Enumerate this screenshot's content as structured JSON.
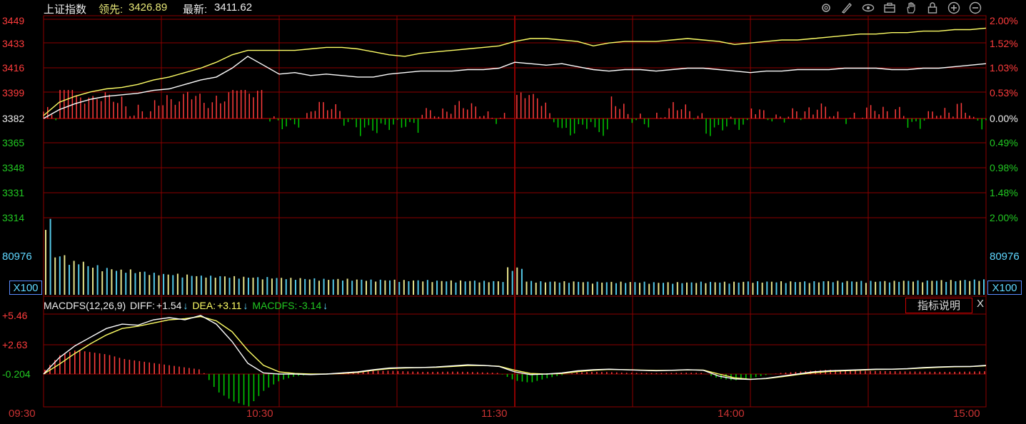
{
  "header": {
    "index_name": "上证指数",
    "lead_label": "领先:",
    "lead_value": "3426.89",
    "latest_label": "最新:",
    "latest_value": "3411.62"
  },
  "toolbar": {
    "icons": [
      "settings-icon",
      "pen-icon",
      "eye-icon",
      "briefcase-icon",
      "hand-icon",
      "lock-icon",
      "zoom-in-icon",
      "zoom-out-icon"
    ]
  },
  "price_axis": {
    "left_ticks": [
      "3449",
      "3433",
      "3416",
      "3399",
      "3382",
      "3365",
      "3348",
      "3331",
      "3314"
    ],
    "right_ticks": [
      "2.00%",
      "1.52%",
      "1.03%",
      "0.53%",
      "0.00%",
      "0.49%",
      "0.98%",
      "1.48%",
      "2.00%"
    ]
  },
  "volume_axis": {
    "max_label": "80976",
    "unit_label": "X100"
  },
  "macd": {
    "name": "MACDFS(12,26,9)",
    "diff_label": "DIFF:",
    "diff_value": "+1.54",
    "dea_label": "DEA:",
    "dea_value": "+3.11",
    "macdfs_label": "MACDFS:",
    "macdfs_value": "-3.14",
    "arrow": "↓",
    "ticks": [
      "+5.46",
      "+2.63",
      "-0.204"
    ],
    "explain_button": "指标说明",
    "close_button": "X"
  },
  "time_axis": [
    "09:30",
    "10:30",
    "11:30",
    "14:00",
    "15:00"
  ],
  "colors": {
    "grid": "#8c0000",
    "up": "#ff3c3c",
    "down": "#00c800",
    "white_line": "#ffffff",
    "yellow_line": "#ffff66",
    "lead_value": "#e8e878",
    "vol_yellow": "#e8e48c",
    "vol_cyan": "#54c8e8",
    "left_up_label": "#ff3c3c",
    "left_down_label": "#00c800"
  },
  "chart_data": {
    "type": "line",
    "title": "上证指数",
    "series": [
      {
        "name": "最新",
        "values": [
          3382,
          3388,
          3392,
          3395,
          3397,
          3398,
          3399,
          3401,
          3402,
          3405,
          3408,
          3410,
          3416,
          3424,
          3418,
          3412,
          3413,
          3411,
          3412,
          3411,
          3410,
          3410,
          3412,
          3413,
          3414,
          3414,
          3414,
          3415,
          3415,
          3416,
          3420,
          3419,
          3418,
          3419,
          3417,
          3415,
          3414,
          3415,
          3415,
          3414,
          3415,
          3416,
          3416,
          3415,
          3414,
          3413,
          3414,
          3414,
          3415,
          3415,
          3415,
          3416,
          3416,
          3416,
          3415,
          3415,
          3416,
          3416,
          3417,
          3418,
          3419
        ]
      },
      {
        "name": "领先",
        "values": [
          3384,
          3393,
          3397,
          3400,
          3402,
          3403,
          3405,
          3408,
          3410,
          3413,
          3416,
          3420,
          3425,
          3428,
          3428,
          3428,
          3428,
          3429,
          3430,
          3430,
          3429,
          3427,
          3425,
          3424,
          3426,
          3427,
          3428,
          3429,
          3430,
          3431,
          3434,
          3436,
          3436,
          3435,
          3434,
          3431,
          3433,
          3434,
          3434,
          3434,
          3435,
          3436,
          3435,
          3434,
          3432,
          3433,
          3434,
          3435,
          3435,
          3436,
          3437,
          3438,
          3439,
          3439,
          3440,
          3440,
          3441,
          3441,
          3442,
          3442,
          3443
        ]
      }
    ],
    "volume": [
      180,
      95,
      80,
      70,
      64,
      60,
      56,
      52,
      50,
      48,
      46,
      45,
      44,
      43,
      42,
      41,
      40,
      39,
      38,
      38,
      37,
      36,
      36,
      35,
      35,
      34,
      34,
      34,
      33,
      33,
      65,
      33,
      32,
      32,
      32,
      31,
      31,
      31,
      31,
      30,
      30,
      30,
      31,
      31,
      31,
      32,
      32,
      32,
      32,
      32,
      33,
      33,
      33,
      33,
      33,
      34,
      34,
      35,
      35,
      36,
      37
    ],
    "volume_unit": "X100",
    "macd_diff": [
      0.0,
      1.5,
      2.6,
      3.4,
      4.2,
      4.6,
      4.5,
      5.0,
      5.2,
      5.0,
      5.4,
      4.6,
      3.0,
      1.0,
      0.1,
      0.0,
      0.0,
      -0.05,
      0.0,
      0.1,
      0.2,
      0.4,
      0.55,
      0.6,
      0.6,
      0.65,
      0.75,
      0.85,
      0.8,
      0.7,
      0.2,
      -0.05,
      0.0,
      0.1,
      0.3,
      0.4,
      0.45,
      0.4,
      0.35,
      0.3,
      0.35,
      0.4,
      0.35,
      -0.2,
      -0.45,
      -0.5,
      -0.4,
      -0.2,
      0.0,
      0.2,
      0.3,
      0.35,
      0.4,
      0.45,
      0.45,
      0.5,
      0.6,
      0.65,
      0.7,
      0.7,
      0.8
    ],
    "macd_dea": [
      0.0,
      0.9,
      1.9,
      2.8,
      3.6,
      4.2,
      4.4,
      4.7,
      5.0,
      5.1,
      5.3,
      4.9,
      3.9,
      2.2,
      0.8,
      0.2,
      0.05,
      0.0,
      0.0,
      0.05,
      0.15,
      0.35,
      0.5,
      0.55,
      0.6,
      0.62,
      0.7,
      0.78,
      0.78,
      0.72,
      0.35,
      0.05,
      0.0,
      0.05,
      0.22,
      0.35,
      0.42,
      0.4,
      0.37,
      0.33,
      0.34,
      0.38,
      0.36,
      0.0,
      -0.35,
      -0.48,
      -0.42,
      -0.25,
      -0.05,
      0.12,
      0.24,
      0.3,
      0.36,
      0.42,
      0.44,
      0.48,
      0.56,
      0.62,
      0.67,
      0.69,
      0.76
    ],
    "macd_hist": [
      0.4,
      1.8,
      2.2,
      2.0,
      1.8,
      1.4,
      1.2,
      1.0,
      0.8,
      0.6,
      0.4,
      -1.6,
      -2.5,
      -3.0,
      -1.5,
      -0.6,
      -0.2,
      -0.05,
      0.05,
      0.15,
      0.25,
      0.3,
      0.3,
      0.25,
      0.2,
      0.2,
      0.22,
      0.2,
      0.15,
      0.1,
      -0.6,
      -0.8,
      -0.4,
      -0.1,
      0.15,
      0.2,
      0.18,
      0.12,
      0.1,
      0.08,
      0.1,
      0.12,
      0.1,
      -0.4,
      -0.6,
      -0.4,
      -0.1,
      0.1,
      0.2,
      0.3,
      0.4,
      0.35,
      0.3,
      0.28,
      0.26,
      0.24,
      0.22,
      0.2,
      0.2,
      0.22,
      0.25
    ],
    "x_ticks": [
      "09:30",
      "10:30",
      "11:30",
      "14:00",
      "15:00"
    ],
    "ylim": [
      3314,
      3449
    ],
    "grid": true
  }
}
